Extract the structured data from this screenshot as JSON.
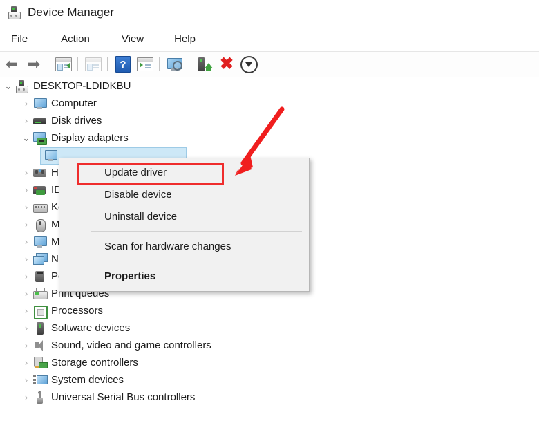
{
  "window": {
    "title": "Device Manager",
    "app_icon": "device-manager-icon"
  },
  "menubar": {
    "items": [
      {
        "label": "File"
      },
      {
        "label": "Action"
      },
      {
        "label": "View"
      },
      {
        "label": "Help"
      }
    ]
  },
  "toolbar": {
    "buttons": [
      {
        "icon": "back-arrow-icon",
        "label": "Back"
      },
      {
        "icon": "forward-arrow-icon",
        "label": "Forward"
      },
      {
        "icon": "properties-panel-icon",
        "label": "Properties"
      },
      {
        "icon": "update-driver-panel-icon",
        "label": "Update Driver Software"
      },
      {
        "icon": "help-question-icon",
        "label": "Help"
      },
      {
        "icon": "show-hidden-panel-icon",
        "label": "Show hidden devices"
      },
      {
        "icon": "scan-hardware-changes-icon",
        "label": "Scan for hardware changes"
      },
      {
        "icon": "update-driver-device-icon",
        "label": "Update driver"
      },
      {
        "icon": "uninstall-red-x-icon",
        "label": "Uninstall device"
      },
      {
        "icon": "disable-device-down-arrow-icon",
        "label": "Disable device"
      }
    ]
  },
  "tree": {
    "root": {
      "label": "DESKTOP-LDIDKBU",
      "icon": "computer-root-icon",
      "expanded": true
    },
    "nodes": [
      {
        "label": "Computer",
        "icon": "computer-icon",
        "expanded": false,
        "level": 1
      },
      {
        "label": "Disk drives",
        "icon": "disk-drive-icon",
        "expanded": false,
        "level": 1
      },
      {
        "label": "Display adapters",
        "icon": "display-adapter-icon",
        "expanded": true,
        "level": 1
      },
      {
        "label": "",
        "icon": "display-device-icon",
        "expanded": false,
        "level": 2,
        "selected": true
      },
      {
        "label": "Human Interface Devices",
        "icon": "human-interface-device-icon",
        "expanded": false,
        "level": 1,
        "obscured": true
      },
      {
        "label": "IDE ATA/ATAPI controllers",
        "icon": "ide-controller-icon",
        "expanded": false,
        "level": 1,
        "obscured": true
      },
      {
        "label": "Keyboards",
        "icon": "keyboard-icon",
        "expanded": false,
        "level": 1,
        "obscured": true
      },
      {
        "label": "Mice and other pointing devices",
        "icon": "mouse-icon",
        "expanded": false,
        "level": 1,
        "obscured": true
      },
      {
        "label": "Monitors",
        "icon": "monitor-icon",
        "expanded": false,
        "level": 1,
        "obscured": true
      },
      {
        "label": "Network adapters",
        "icon": "network-adapter-icon",
        "expanded": false,
        "level": 1,
        "obscured": true
      },
      {
        "label": "Ports (COM & LPT)",
        "icon": "port-icon",
        "expanded": false,
        "level": 1
      },
      {
        "label": "Print queues",
        "icon": "printer-icon",
        "expanded": false,
        "level": 1
      },
      {
        "label": "Processors",
        "icon": "processor-icon",
        "expanded": false,
        "level": 1
      },
      {
        "label": "Software devices",
        "icon": "software-device-icon",
        "expanded": false,
        "level": 1
      },
      {
        "label": "Sound, video and game controllers",
        "icon": "sound-controller-icon",
        "expanded": false,
        "level": 1
      },
      {
        "label": "Storage controllers",
        "icon": "storage-controller-icon",
        "expanded": false,
        "level": 1
      },
      {
        "label": "System devices",
        "icon": "system-device-icon",
        "expanded": false,
        "level": 1
      },
      {
        "label": "Universal Serial Bus controllers",
        "icon": "usb-controller-icon",
        "expanded": false,
        "level": 1
      }
    ],
    "chevron_collapsed": "›",
    "chevron_expanded": "⌄"
  },
  "context_menu": {
    "items": [
      {
        "label": "Update driver",
        "bold": false,
        "highlighted": true
      },
      {
        "label": "Disable device",
        "bold": false,
        "highlighted": false
      },
      {
        "label": "Uninstall device",
        "bold": false,
        "highlighted": false
      },
      {
        "separator": true
      },
      {
        "label": "Scan for hardware changes",
        "bold": false,
        "highlighted": false
      },
      {
        "separator": true
      },
      {
        "label": "Properties",
        "bold": true,
        "highlighted": false
      }
    ]
  },
  "annotations": {
    "highlight_color": "#ef2d2d",
    "arrow_color": "#f01e1e",
    "arrow_target": "Update driver"
  },
  "colors": {
    "selection_blue": "#cde8f7",
    "menu_background": "#f1f1f1",
    "text": "#1b1b1b"
  }
}
